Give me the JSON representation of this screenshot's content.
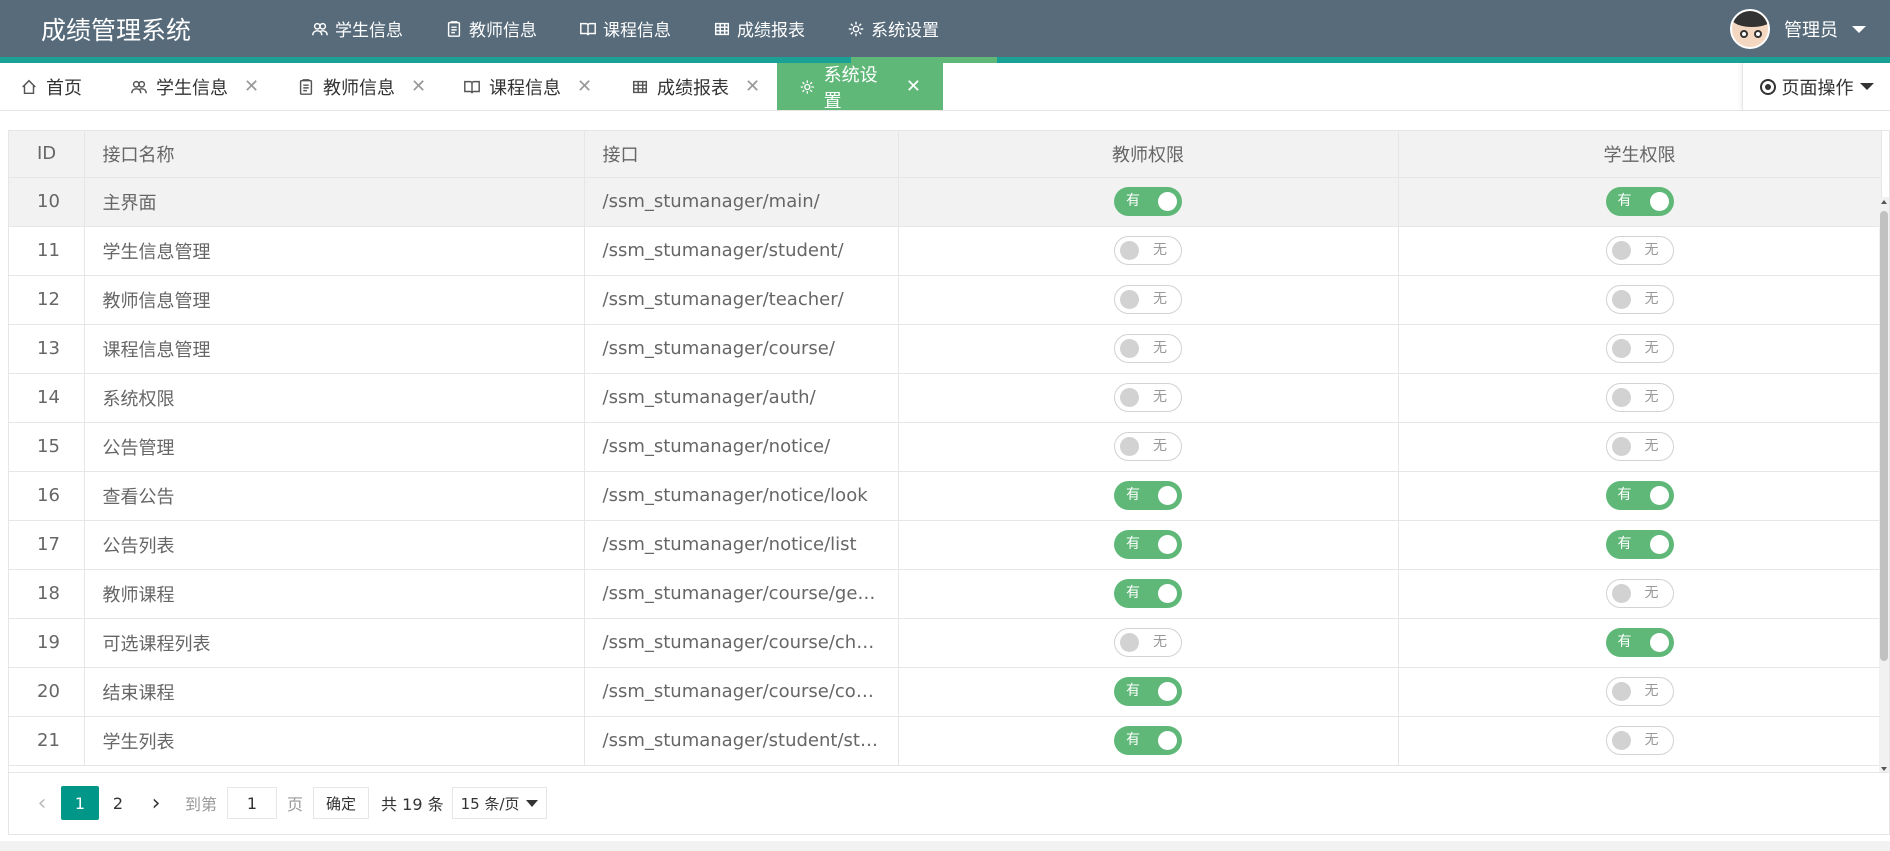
{
  "header": {
    "app_title": "成绩管理系统",
    "nav": [
      {
        "label": "学生信息",
        "icon": "users-icon"
      },
      {
        "label": "教师信息",
        "icon": "clipboard-icon"
      },
      {
        "label": "课程信息",
        "icon": "book-icon"
      },
      {
        "label": "成绩报表",
        "icon": "table-icon"
      },
      {
        "label": "系统设置",
        "icon": "gear-icon"
      }
    ],
    "user_name": "管理员"
  },
  "tabs": [
    {
      "label": "首页",
      "icon": "home-icon"
    },
    {
      "label": "学生信息",
      "icon": "users-icon"
    },
    {
      "label": "教师信息",
      "icon": "clipboard-icon"
    },
    {
      "label": "课程信息",
      "icon": "book-icon"
    },
    {
      "label": "成绩报表",
      "icon": "table-icon"
    },
    {
      "label": "系统设置",
      "icon": "gear-icon",
      "active": true
    }
  ],
  "page_ops_label": "页面操作",
  "table": {
    "columns": [
      "ID",
      "接口名称",
      "接口",
      "教师权限",
      "学生权限"
    ],
    "rows": [
      {
        "id": "10",
        "name": "主界面",
        "api": "/ssm_stumanager/main/",
        "teacher": "有",
        "student": "有"
      },
      {
        "id": "11",
        "name": "学生信息管理",
        "api": "/ssm_stumanager/student/",
        "teacher": "无",
        "student": "无"
      },
      {
        "id": "12",
        "name": "教师信息管理",
        "api": "/ssm_stumanager/teacher/",
        "teacher": "无",
        "student": "无"
      },
      {
        "id": "13",
        "name": "课程信息管理",
        "api": "/ssm_stumanager/course/",
        "teacher": "无",
        "student": "无"
      },
      {
        "id": "14",
        "name": "系统权限",
        "api": "/ssm_stumanager/auth/",
        "teacher": "无",
        "student": "无"
      },
      {
        "id": "15",
        "name": "公告管理",
        "api": "/ssm_stumanager/notice/",
        "teacher": "无",
        "student": "无"
      },
      {
        "id": "16",
        "name": "查看公告",
        "api": "/ssm_stumanager/notice/look",
        "teacher": "有",
        "student": "有"
      },
      {
        "id": "17",
        "name": "公告列表",
        "api": "/ssm_stumanager/notice/list",
        "teacher": "有",
        "student": "有"
      },
      {
        "id": "18",
        "name": "教师课程",
        "api": "/ssm_stumanager/course/getMy…",
        "teacher": "有",
        "student": "无"
      },
      {
        "id": "19",
        "name": "可选课程列表",
        "api": "/ssm_stumanager/course/choice…",
        "teacher": "无",
        "student": "有"
      },
      {
        "id": "20",
        "name": "结束课程",
        "api": "/ssm_stumanager/course/complete",
        "teacher": "有",
        "student": "无"
      },
      {
        "id": "21",
        "name": "学生列表",
        "api": "/ssm_stumanager/student/stulist",
        "teacher": "有",
        "student": "无"
      }
    ]
  },
  "pagination": {
    "pages": [
      "1",
      "2"
    ],
    "current": "1",
    "goto_label": "到第",
    "goto_value": "1",
    "page_label": "页",
    "confirm_label": "确定",
    "total_label": "共 19 条",
    "page_size": "15 条/页"
  },
  "colors": {
    "header": "#576b7b",
    "accent": "#1aa094",
    "active_tab": "#5fb878",
    "pager_current": "#009688"
  }
}
